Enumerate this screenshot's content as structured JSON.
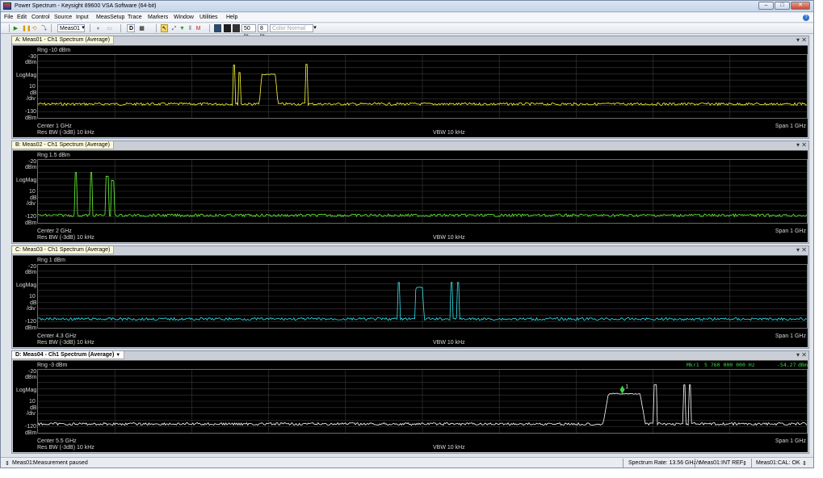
{
  "window": {
    "title": "Power Spectrum - Keysight 89600 VSA Software (64-bit)",
    "min": "–",
    "max": "□",
    "close": "✕"
  },
  "menu": [
    "File",
    "Edit",
    "Control",
    "Source",
    "Input",
    "MeasSetup",
    "Trace",
    "Markers",
    "Window",
    "Utilities",
    "Help"
  ],
  "help_glyph": "?",
  "toolbar": {
    "meas_select": "Meas01",
    "zoom1": "50 %",
    "zoom2": "8 %",
    "color_mode": "Color Normal",
    "d_btn": "D"
  },
  "colors": {
    "yellow": "#ffff33",
    "green": "#66ff33",
    "cyan": "#33e5ef",
    "white": "#ffffff",
    "marker": "#3fd14a",
    "plot_bg": "#000000"
  },
  "panes": [
    {
      "title": "A: Meas01 - Ch1 Spectrum (Average)",
      "rng": "Rng -10 dBm",
      "top_val": "-30",
      "top_unit": "dBm",
      "scale": [
        "LogMag",
        "10",
        "dB",
        "/div"
      ],
      "bot_val": "-130",
      "bot_unit": "dBm",
      "center": "Center 1 GHz",
      "span": "Span 1 GHz",
      "rbw": "Res BW (-3dB) 10 kHz",
      "vbw": "VBW 10 kHz",
      "trace_color": "#ffff33",
      "noise_frac": 0.78,
      "features": [
        {
          "type": "spike",
          "x": 0.255,
          "h": 0.62
        },
        {
          "type": "spike",
          "x": 0.262,
          "h": 0.5
        },
        {
          "type": "block",
          "x1": 0.288,
          "x2": 0.312,
          "h": 0.47
        },
        {
          "type": "spike",
          "x": 0.349,
          "h": 0.63
        }
      ]
    },
    {
      "title": "B: Meas02 - Ch1 Spectrum (Average)",
      "rng": "Rng 1.5 dBm",
      "top_val": "-20",
      "top_unit": "dBm",
      "scale": [
        "LogMag",
        "10",
        "dB",
        "/div"
      ],
      "bot_val": "-120",
      "bot_unit": "dBm",
      "center": "Center 2 GHz",
      "span": "Span 1 GHz",
      "rbw": "Res BW (-3dB) 10 kHz",
      "vbw": "VBW 10 kHz",
      "trace_color": "#66ff33",
      "noise_frac": 0.88,
      "features": [
        {
          "type": "spike",
          "x": 0.049,
          "h": 0.68
        },
        {
          "type": "spike",
          "x": 0.069,
          "h": 0.68
        },
        {
          "type": "spike",
          "x": 0.09,
          "h": 0.62
        },
        {
          "type": "block",
          "x1": 0.095,
          "x2": 0.1,
          "h": 0.55
        }
      ]
    },
    {
      "title": "C: Meas03 - Ch1 Spectrum (Average)",
      "rng": "Rng 1 dBm",
      "top_val": "-20",
      "top_unit": "dBm",
      "scale": [
        "LogMag",
        "10",
        "dB",
        "/div"
      ],
      "bot_val": "-120",
      "bot_unit": "dBm",
      "center": "Center 4.3 GHz",
      "span": "Span 1 GHz",
      "rbw": "Res BW (-3dB) 10 kHz",
      "vbw": "VBW 10 kHz",
      "trace_color": "#33e5ef",
      "noise_frac": 0.86,
      "features": [
        {
          "type": "spike",
          "x": 0.469,
          "h": 0.58
        },
        {
          "type": "block",
          "x1": 0.49,
          "x2": 0.502,
          "h": 0.5
        },
        {
          "type": "spike",
          "x": 0.538,
          "h": 0.58
        },
        {
          "type": "spike",
          "x": 0.546,
          "h": 0.58
        }
      ]
    },
    {
      "title": "D: Meas04 - Ch1 Spectrum (Average)",
      "rng": "Rng -3 dBm",
      "top_val": "-20",
      "top_unit": "dBm",
      "scale": [
        "LogMag",
        "10",
        "dB",
        "/div"
      ],
      "bot_val": "-120",
      "bot_unit": "dBm",
      "center": "Center 5.5 GHz",
      "span": "Span 1 GHz",
      "rbw": "Res BW (-3dB) 10 kHz",
      "vbw": "VBW 10 kHz",
      "trace_color": "#ffffff",
      "noise_frac": 0.86,
      "marker": {
        "label": "Mkr1",
        "freq": "5 760 000 000 Hz",
        "value": "-54.27",
        "unit": "dBm",
        "num": "1",
        "x": 0.76
      },
      "features": [
        {
          "type": "block",
          "x1": 0.735,
          "x2": 0.79,
          "h": 0.48
        },
        {
          "type": "spike",
          "x": 0.803,
          "h": 0.62
        },
        {
          "type": "spike",
          "x": 0.841,
          "h": 0.62
        },
        {
          "type": "spike",
          "x": 0.848,
          "h": 0.62
        }
      ]
    }
  ],
  "pane_dropdown": "▼",
  "pane_ctrl": "▾ ✕",
  "status": {
    "left_meas": "Meas01:",
    "left_msg": "Measurement paused",
    "rate": "Spectrum Rate: 13.56 GHz/s",
    "ref_meas": "Meas01:",
    "ref": "INT REF",
    "cal_meas": "Meas01:",
    "cal": "CAL: OK"
  }
}
